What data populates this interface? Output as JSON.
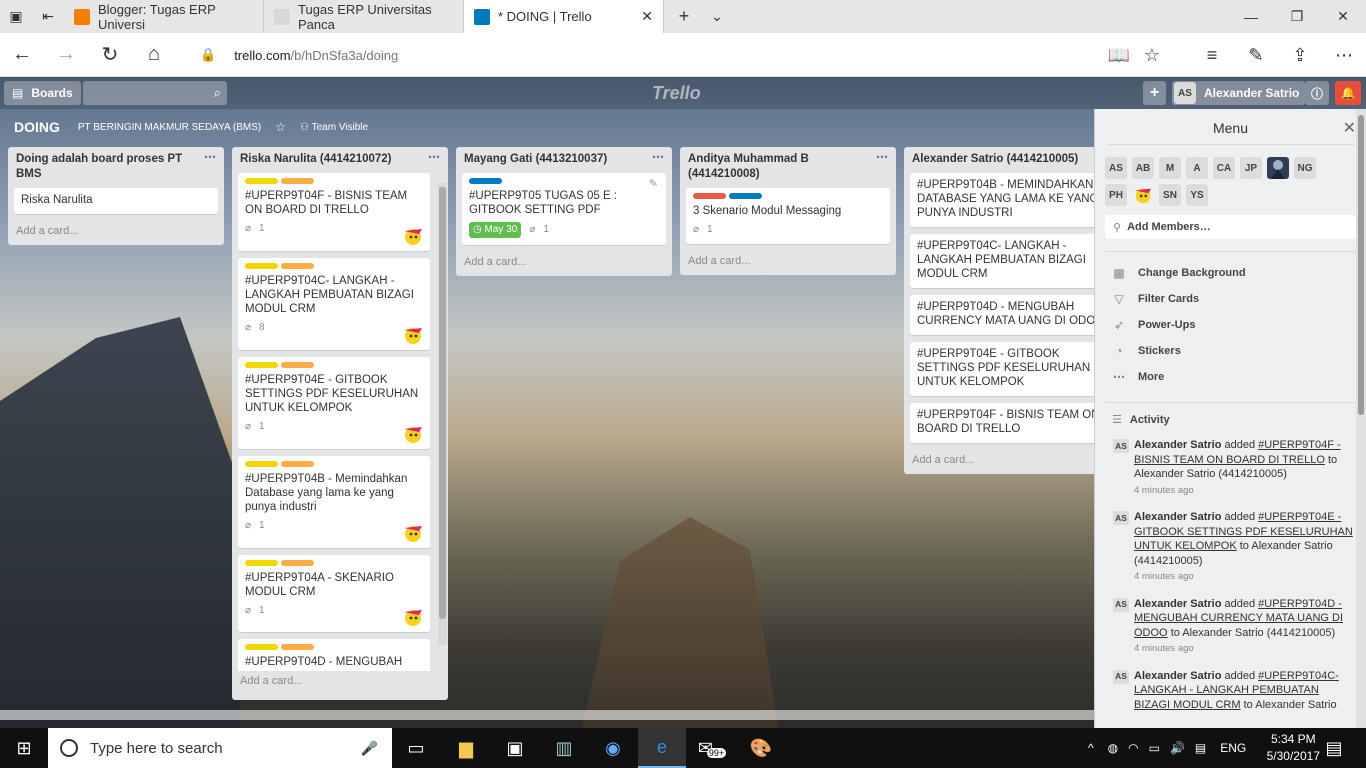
{
  "browser": {
    "tabs": [
      {
        "title": "Blogger: Tugas ERP Universi",
        "color": "#f57d00"
      },
      {
        "title": "Tugas ERP Universitas Panca",
        "color": "#d8d8d8"
      },
      {
        "title": "* DOING | Trello",
        "color": "#0079bf"
      }
    ],
    "url_host": "trello.com",
    "url_path": "/b/hDnSfa3a/doing"
  },
  "header": {
    "boards_label": "Boards",
    "logo": "Trello",
    "user_initials": "AS",
    "user_name": "Alexander Satrio"
  },
  "board": {
    "title": "DOING",
    "team": "PT BERINGIN MAKMUR SEDAYA (BMS)",
    "visibility": "Team Visible"
  },
  "lists": [
    {
      "title": "Doing adalah board proses PT BMS",
      "cards": [
        {
          "title": "Riska Narulita"
        }
      ],
      "add_label": "Add a card..."
    },
    {
      "title": "Riska Narulita (4414210072)",
      "cards": [
        {
          "title": "#UPERP9T04F - BISNIS TEAM ON BOARD DI TRELLO",
          "attachments": "1"
        },
        {
          "title": "#UPERP9T04C- LANGKAH - LANGKAH PEMBUATAN BIZAGI MODUL CRM",
          "attachments": "8"
        },
        {
          "title": "#UPERP9T04E - GITBOOK SETTINGS PDF KESELURUHAN UNTUK KELOMPOK",
          "attachments": "1"
        },
        {
          "title": "#UPERP9T04B - Memindahkan Database yang lama ke yang punya industri",
          "attachments": "1"
        },
        {
          "title": "#UPERP9T04A - SKENARIO MODUL CRM",
          "attachments": "1"
        },
        {
          "title": "#UPERP9T04D - MENGUBAH"
        }
      ],
      "add_label": "Add a card..."
    },
    {
      "title": "Mayang Gati (4413210037)",
      "cards": [
        {
          "title": "#UPERP9T05 TUGAS 05 E : GITBOOK SETTING PDF",
          "due": "May 30",
          "attachments": "1"
        }
      ],
      "add_label": "Add a card..."
    },
    {
      "title": "Anditya Muhammad B (4414210008)",
      "cards": [
        {
          "title": "3 Skenario Modul Messaging",
          "attachments": "1"
        }
      ],
      "add_label": "Add a card..."
    },
    {
      "title": "Alexander Satrio (4414210005)",
      "cards": [
        {
          "title": "#UPERP9T04B - MEMINDAHKAN DATABASE YANG LAMA KE YANG PUNYA INDUSTRI"
        },
        {
          "title": "#UPERP9T04C- LANGKAH - LANGKAH PEMBUATAN BIZAGI MODUL CRM"
        },
        {
          "title": "#UPERP9T04D - MENGUBAH CURRENCY MATA UANG DI ODOO"
        },
        {
          "title": "#UPERP9T04E - GITBOOK SETTINGS PDF KESELURUHAN UNTUK KELOMPOK"
        },
        {
          "title": "#UPERP9T04F - BISNIS TEAM ON BOARD DI TRELLO"
        }
      ],
      "add_label": "Add a card..."
    }
  ],
  "menu": {
    "title": "Menu",
    "members": [
      "AS",
      "AB",
      "M",
      "A",
      "CA",
      "JP",
      "",
      "NG",
      "PH",
      "",
      "SN",
      "YS"
    ],
    "add_members": "Add Members…",
    "items": [
      "Change Background",
      "Filter Cards",
      "Power-Ups",
      "Stickers",
      "More"
    ],
    "activity_title": "Activity",
    "activity": [
      {
        "who": "Alexander Satrio",
        "verb": "added",
        "card": "#UPERP9T04F - BISNIS TEAM ON BOARD DI TRELLO",
        "to": "to Alexander Satrio (4414210005)",
        "time": "4 minutes ago"
      },
      {
        "who": "Alexander Satrio",
        "verb": "added",
        "card": "#UPERP9T04E - GITBOOK SETTINGS PDF KESELURUHAN UNTUK KELOMPOK",
        "to": "to Alexander Satrio (4414210005)",
        "time": "4 minutes ago"
      },
      {
        "who": "Alexander Satrio",
        "verb": "added",
        "card": "#UPERP9T04D - MENGUBAH CURRENCY MATA UANG DI ODOO",
        "to": "to Alexander Satrio (4414210005)",
        "time": "4 minutes ago"
      },
      {
        "who": "Alexander Satrio",
        "verb": "added",
        "card": "#UPERP9T04C- LANGKAH - LANGKAH PEMBUATAN BIZAGI MODUL CRM",
        "to": "to Alexander Satrio",
        "time": ""
      }
    ]
  },
  "taskbar": {
    "search_placeholder": "Type here to search",
    "badge": "99+",
    "lang": "ENG",
    "time": "5:34 PM",
    "date": "5/30/2017"
  },
  "colors": {
    "label_yellow": "#f2d600",
    "label_orange": "#ffab4a",
    "label_blue": "#0079bf",
    "label_red": "#eb5a46",
    "due_green": "#61bd4f",
    "notification": "#e74c3c"
  }
}
